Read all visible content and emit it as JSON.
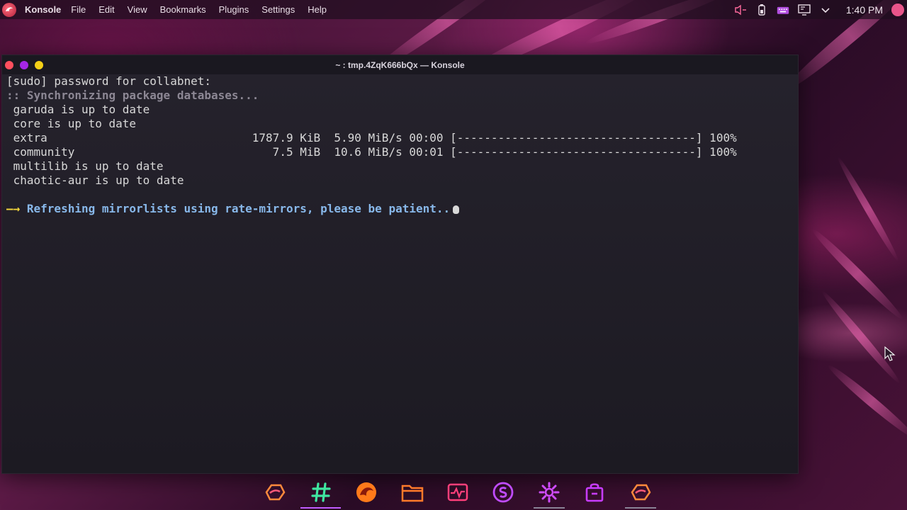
{
  "topbar": {
    "app_name": "Konsole",
    "menu": [
      "File",
      "Edit",
      "View",
      "Bookmarks",
      "Plugins",
      "Settings",
      "Help"
    ],
    "clock": "1:40 PM",
    "tray_icons": [
      "volume-muted-icon",
      "battery-icon",
      "keyboard-icon",
      "display-icon",
      "chevron-down-icon"
    ]
  },
  "window": {
    "title": "~ : tmp.4ZqK666bQx — Konsole",
    "buttons": [
      "close",
      "minimize",
      "maximize"
    ]
  },
  "terminal": {
    "lines": {
      "l1": "[sudo] password for collabnet:",
      "l2": ":: Synchronizing package databases...",
      "l3": " garuda is up to date",
      "l4": " core is up to date",
      "l5": " extra                              1787.9 KiB  5.90 MiB/s 00:00 [-----------------------------------] 100%",
      "l6": " community                             7.5 MiB  10.6 MiB/s 00:01 [-----------------------------------] 100%",
      "l7": " multilib is up to date",
      "l8": " chaotic-aur is up to date",
      "l9_arrow": "—→",
      "l9_text": " Refreshing mirrorlists using rate-mirrors, please be patient.."
    },
    "progress": {
      "extra": 1.0,
      "community": 1.0
    }
  },
  "dock": {
    "items": [
      "garuda-welcome-icon",
      "hashtag-icon",
      "dragon-browser-icon",
      "files-icon",
      "system-monitor-icon",
      "s-app-icon",
      "settings-gear-icon",
      "software-bag-icon",
      "garuda-settings-icon"
    ]
  },
  "colors": {
    "accent_purple": "#a526e6",
    "close_red": "#ff4f5e",
    "max_yellow": "#f4cf17",
    "arrow_yellow": "#f7d93c",
    "info_blue": "#88b8ea",
    "terminal_bg": "#1d1a24"
  }
}
